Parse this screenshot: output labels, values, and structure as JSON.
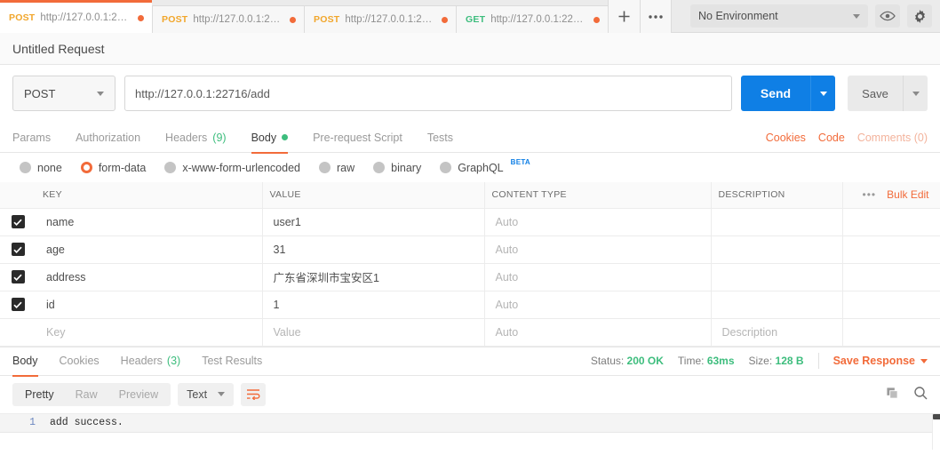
{
  "topbar": {
    "tabs": [
      {
        "method": "POST",
        "method_class": "post",
        "url": "http://127.0.0.1:227…",
        "active": true
      },
      {
        "method": "POST",
        "method_class": "post",
        "url": "http://127.0.0.1:227…",
        "active": false
      },
      {
        "method": "POST",
        "method_class": "post",
        "url": "http://127.0.0.1:227…",
        "active": false
      },
      {
        "method": "GET",
        "method_class": "get",
        "url": "http://127.0.0.1:2271…",
        "active": false
      }
    ],
    "new_tab_icon": "plus-icon",
    "more_tabs_icon": "ellipsis-icon",
    "environment": "No Environment",
    "eye_icon": "eye-icon",
    "settings_icon": "gear-icon"
  },
  "request": {
    "title": "Untitled Request",
    "method": "POST",
    "url": "http://127.0.0.1:22716/add",
    "send_label": "Send",
    "save_label": "Save",
    "tabs": [
      {
        "label": "Params",
        "count": "",
        "active": false,
        "dot": false
      },
      {
        "label": "Authorization",
        "count": "",
        "active": false,
        "dot": false
      },
      {
        "label": "Headers",
        "count": "(9)",
        "active": false,
        "dot": false
      },
      {
        "label": "Body",
        "count": "",
        "active": true,
        "dot": true
      },
      {
        "label": "Pre-request Script",
        "count": "",
        "active": false,
        "dot": false
      },
      {
        "label": "Tests",
        "count": "",
        "active": false,
        "dot": false
      }
    ],
    "links": {
      "cookies": "Cookies",
      "code": "Code",
      "comments": "Comments (0)"
    }
  },
  "body_types": [
    {
      "label": "none",
      "checked": false,
      "beta": ""
    },
    {
      "label": "form-data",
      "checked": true,
      "beta": ""
    },
    {
      "label": "x-www-form-urlencoded",
      "checked": false,
      "beta": ""
    },
    {
      "label": "raw",
      "checked": false,
      "beta": ""
    },
    {
      "label": "binary",
      "checked": false,
      "beta": ""
    },
    {
      "label": "GraphQL",
      "checked": false,
      "beta": "BETA"
    }
  ],
  "form_table": {
    "headers": {
      "key": "KEY",
      "value": "VALUE",
      "content_type": "CONTENT TYPE",
      "description": "DESCRIPTION",
      "dots": "•••",
      "bulk_edit": "Bulk Edit"
    },
    "rows": [
      {
        "checked": true,
        "key": "name",
        "value": "user1",
        "content_type": "Auto",
        "description": "",
        "placeholder": false
      },
      {
        "checked": true,
        "key": "age",
        "value": "31",
        "content_type": "Auto",
        "description": "",
        "placeholder": false
      },
      {
        "checked": true,
        "key": "address",
        "value": "广东省深圳市宝安区1",
        "content_type": "Auto",
        "description": "",
        "placeholder": false
      },
      {
        "checked": true,
        "key": "id",
        "value": "1",
        "content_type": "Auto",
        "description": "",
        "placeholder": false
      },
      {
        "checked": false,
        "key": "Key",
        "value": "Value",
        "content_type": "Auto",
        "description": "Description",
        "placeholder": true
      }
    ]
  },
  "response": {
    "tabs": [
      {
        "label": "Body",
        "count": "",
        "active": true
      },
      {
        "label": "Cookies",
        "count": "",
        "active": false
      },
      {
        "label": "Headers",
        "count": "(3)",
        "active": false
      },
      {
        "label": "Test Results",
        "count": "",
        "active": false
      }
    ],
    "meta": {
      "status_label": "Status:",
      "status_value": "200 OK",
      "time_label": "Time:",
      "time_value": "63ms",
      "size_label": "Size:",
      "size_value": "128 B",
      "save_response": "Save Response"
    },
    "view_modes": [
      {
        "label": "Pretty",
        "active": true
      },
      {
        "label": "Raw",
        "active": false
      },
      {
        "label": "Preview",
        "active": false
      }
    ],
    "format": "Text",
    "wrap_icon": "word-wrap-icon",
    "copy_icon": "copy-icon",
    "search_icon": "search-icon",
    "body_lines": [
      {
        "number": "1",
        "text": "add success."
      }
    ]
  },
  "colors": {
    "accent_orange": "#f26b3a",
    "send_blue": "#0f7fe5",
    "green": "#3dbd7d",
    "post_yellow": "#f1a62b"
  }
}
